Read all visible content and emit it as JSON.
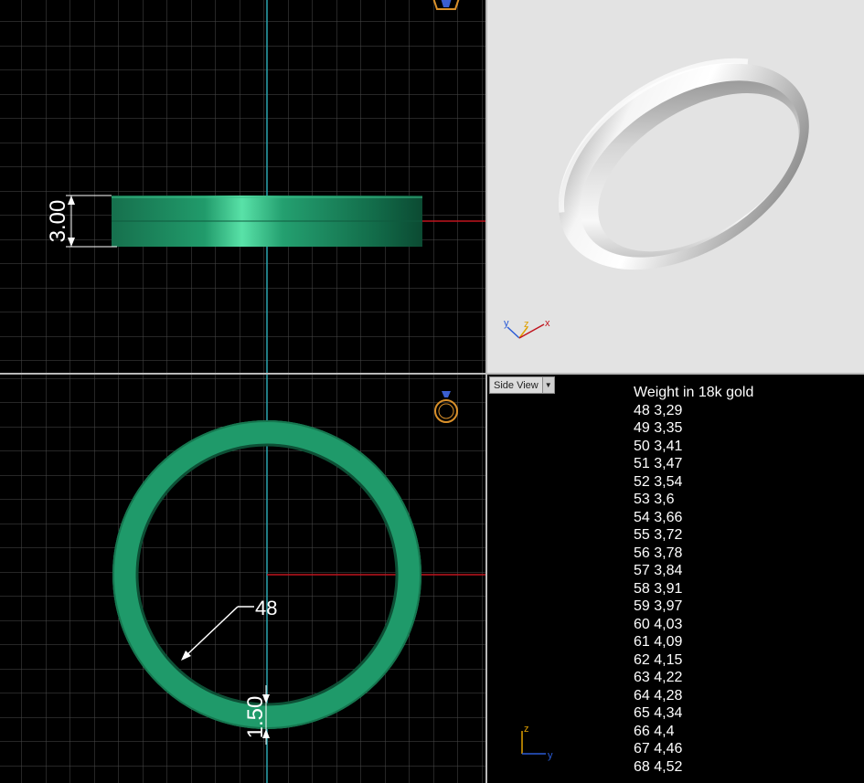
{
  "viewports": {
    "front": {
      "dimension_height": "3.00"
    },
    "top": {
      "dimension_diameter": "48",
      "dimension_thickness": "1.50"
    },
    "perspective": {
      "axis_labels": {
        "y": "y",
        "z": "z",
        "x": "x"
      }
    },
    "side": {
      "label": "Side View",
      "dropdown_icon": "▼",
      "axis_labels": {
        "z": "z",
        "y": "y"
      }
    }
  },
  "weights": {
    "title": "Weight in 18k gold",
    "rows": [
      "48 3,29",
      "49 3,35",
      "50 3,41",
      "51 3,47",
      "52 3,54",
      "53 3,6",
      "54 3,66",
      "55 3,72",
      "56 3,78",
      "57 3,84",
      "58 3,91",
      "59 3,97",
      "60 4,03",
      "61 4,09",
      "62 4,15",
      "63 4,22",
      "64 4,28",
      "65 4,34",
      "66 4,4",
      "67 4,46",
      "68 4,52"
    ]
  },
  "colors": {
    "grid": "#4a4a4a",
    "grid_major": "#8a8a8a",
    "ring_green": "#1f8f64",
    "axis_red": "#c0141e",
    "axis_cyan": "#2aa6b0",
    "ring_icon": "#d9902a"
  },
  "icons": [
    "ring-preview-icon",
    "view-cube-icon",
    "dropdown-arrow-icon"
  ]
}
